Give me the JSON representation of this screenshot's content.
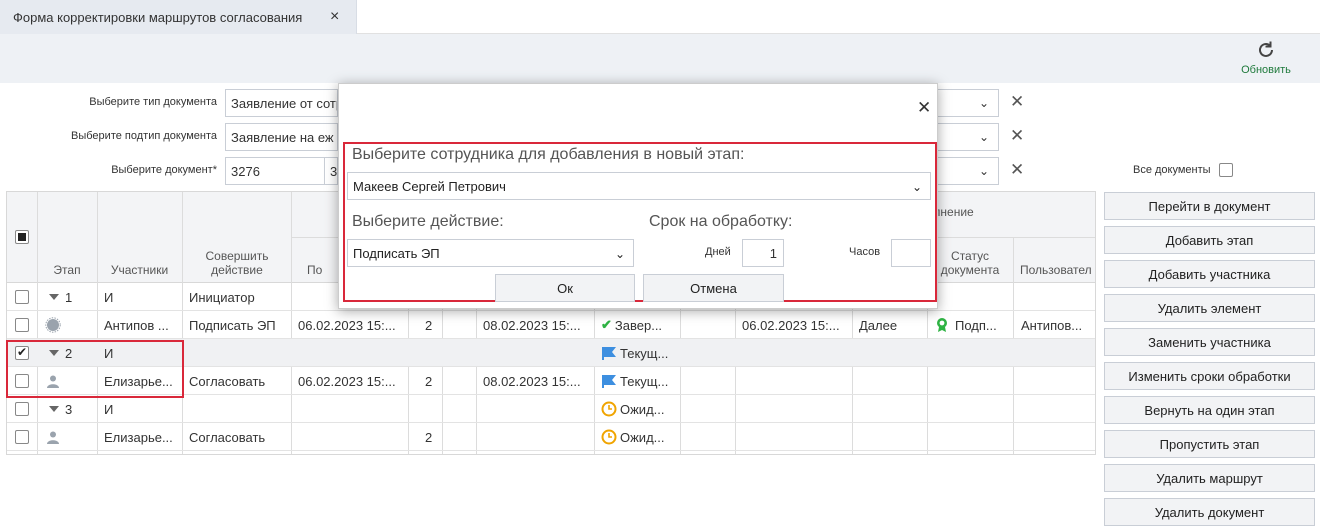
{
  "tab": {
    "title": "Форма корректировки маршрутов согласования",
    "close_icon": "×"
  },
  "toolbar": {
    "refresh_label": "Обновить",
    "accent": "#1f7a3c"
  },
  "filters": {
    "doc_type_label": "Выберите тип документа",
    "doc_type_value": "Заявление от сотр",
    "doc_subtype_label": "Выберите подтип документа",
    "doc_subtype_value": "Заявление на еж",
    "doc_label": "Выберите документ*",
    "doc_value": "3276",
    "doc_value2": "3",
    "all_docs_label": "Все документы"
  },
  "table": {
    "headers": {
      "stage": "Этап",
      "participants": "Участники",
      "action": "Совершить действие",
      "col_po": "По",
      "execution_group": "олнение",
      "doc_status": "Статус документа",
      "user": "Пользовател"
    },
    "rows": [
      {
        "stage": "1",
        "participant": "И",
        "action": "Инициатор",
        "date1": "",
        "n": "",
        "date2": "",
        "status": "",
        "date3": "",
        "next": "",
        "doc_status": "",
        "user": ""
      },
      {
        "stage": "",
        "participant": "Антипов ...",
        "action": "Подписать ЭП",
        "date1": "06.02.2023 15:...",
        "n": "2",
        "date2": "08.02.2023 15:...",
        "status": "Завер...",
        "date3": "06.02.2023 15:...",
        "next": "Далее",
        "doc_status": "Подп...",
        "user": "Антипов..."
      },
      {
        "stage": "2",
        "participant": "И",
        "action": "",
        "date1": "",
        "n": "",
        "date2": "",
        "status": "Текущ...",
        "date3": "",
        "next": "",
        "doc_status": "",
        "user": ""
      },
      {
        "stage": "",
        "participant": "Елизарье...",
        "action": "Согласовать",
        "date1": "06.02.2023 15:...",
        "n": "2",
        "date2": "08.02.2023 15:...",
        "status": "Текущ...",
        "date3": "",
        "next": "",
        "doc_status": "",
        "user": ""
      },
      {
        "stage": "3",
        "participant": "И",
        "action": "",
        "date1": "",
        "n": "",
        "date2": "",
        "status": "Ожид...",
        "date3": "",
        "next": "",
        "doc_status": "",
        "user": ""
      },
      {
        "stage": "",
        "participant": "Елизарье...",
        "action": "Согласовать",
        "date1": "",
        "n": "2",
        "date2": "",
        "status": "Ожид...",
        "date3": "",
        "next": "",
        "doc_status": "",
        "user": ""
      }
    ]
  },
  "buttons": {
    "go_to_doc": "Перейти в документ",
    "add_stage": "Добавить этап",
    "add_participant": "Добавить участника",
    "delete_element": "Удалить элемент",
    "replace_participant": "Заменить участника",
    "change_deadlines": "Изменить сроки обработки",
    "back_one_stage": "Вернуть на один этап",
    "skip_stage": "Пропустить этап",
    "delete_route": "Удалить маршрут",
    "delete_document": "Удалить документ"
  },
  "modal": {
    "select_employee_label": "Выберите сотрудника для добавления в новый этап:",
    "employee_value": "Макеев Сергей Петрович",
    "select_action_label": "Выберите действие:",
    "action_value": "Подписать ЭП",
    "deadline_label": "Срок на обработку:",
    "days_label": "Дней",
    "days_value": "1",
    "hours_label": "Часов",
    "hours_value": "",
    "ok_label": "Ок",
    "cancel_label": "Отмена",
    "highlight_color": "#d9283a"
  }
}
